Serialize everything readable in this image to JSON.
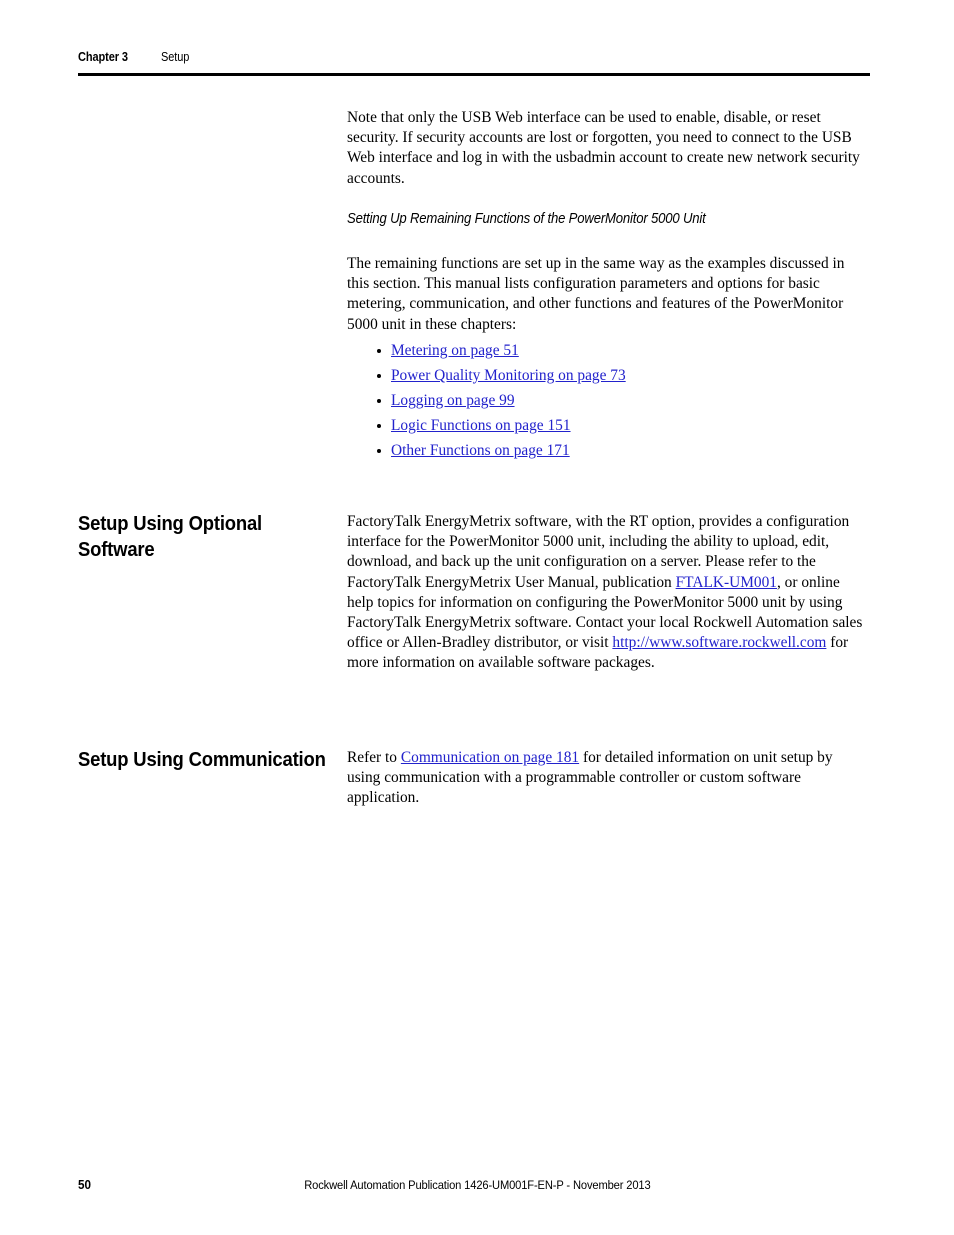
{
  "header": {
    "chapter_label": "Chapter 3",
    "chapter_title": "Setup"
  },
  "main": {
    "intro_paragraph": "Note that only the USB Web interface can be used to enable, disable, or reset security. If security accounts are lost or forgotten, you need to connect to the USB Web interface and log in with the usbadmin account to create new network security accounts.",
    "subheading": "Setting Up Remaining Functions of the PowerMonitor 5000 Unit",
    "remaining_functions_paragraph": "The remaining functions are set up in the same way as the examples discussed in this section. This manual lists configuration parameters and options for basic metering, communication, and other functions and features of the PowerMonitor 5000 unit in these chapters:",
    "xref_list": [
      {
        "label": "Metering on page 51"
      },
      {
        "label": "Power Quality Monitoring on page 73"
      },
      {
        "label": "Logging on page 99"
      },
      {
        "label": "Logic Functions on page 151"
      },
      {
        "label": "Other Functions on page 171"
      }
    ]
  },
  "sections": {
    "optional_software": {
      "heading": "Setup Using Optional Software",
      "text_1": "FactoryTalk EnergyMetrix software, with the RT option, provides a configuration interface for the PowerMonitor 5000 unit, including the ability to upload, edit, download, and back up the unit configuration on a server. Please refer to the FactoryTalk EnergyMetrix User Manual, publication ",
      "link_1": "FTALK-UM001",
      "text_2": ", or online help topics for information on configuring the PowerMonitor 5000 unit by using FactoryTalk EnergyMetrix software. Contact your local Rockwell Automation sales office or Allen-Bradley distributor, or visit ",
      "link_2": "http://www.software.rockwell.com",
      "text_3": " for more information on available software packages."
    },
    "communication": {
      "heading": "Setup Using Communication",
      "text_1": "Refer to ",
      "link_1": "Communication on page 181",
      "text_2": " for detailed information on unit setup by using communication with a programmable controller or custom software application."
    }
  },
  "footer": {
    "page_number": "50",
    "publication": "Rockwell Automation Publication 1426-UM001F-EN-P - November 2013"
  },
  "colors": {
    "link": "#2222cc",
    "text": "#000000",
    "rule": "#000000"
  }
}
